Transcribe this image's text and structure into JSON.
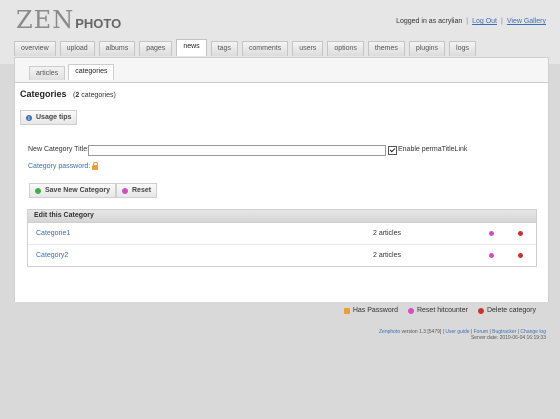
{
  "header": {
    "logo_zen": "ZEN",
    "logo_photo": "PHOTO",
    "logged_in_text": "Logged in as acrylian",
    "logout_label": "Log Out",
    "view_gallery_label": "View Gallery",
    "separator": "|"
  },
  "tabs": [
    {
      "label": "overview"
    },
    {
      "label": "upload"
    },
    {
      "label": "albums"
    },
    {
      "label": "pages"
    },
    {
      "label": "news",
      "active": true
    },
    {
      "label": "tags"
    },
    {
      "label": "comments"
    },
    {
      "label": "users"
    },
    {
      "label": "options"
    },
    {
      "label": "themes"
    },
    {
      "label": "plugins"
    },
    {
      "label": "logs"
    }
  ],
  "subtabs": [
    {
      "label": "articles"
    },
    {
      "label": "categories",
      "active": true
    }
  ],
  "page": {
    "title": "Categories",
    "count_open": "(",
    "count_value": "2",
    "count_rest": " categories)",
    "usage_tips_label": "Usage tips"
  },
  "form": {
    "title_label": "New Category Title:",
    "title_value": "",
    "permalink_label": "Enable permaTitleLink",
    "permalink_checked": true,
    "password_label": "Category password:",
    "save_label": "Save New Category",
    "reset_label": "Reset"
  },
  "table": {
    "header": "Edit this Category",
    "rows": [
      {
        "name": "Categorie1",
        "articles": "2 articles"
      },
      {
        "name": "Category2",
        "articles": "2 articles"
      }
    ]
  },
  "legend": {
    "has_password": "Has Password",
    "reset_hitcounter": "Reset hitcounter",
    "delete_category": "Delete category"
  },
  "footer": {
    "brand": "Zenphoto",
    "version_text": " version 1.3 [5479] | ",
    "user_guide": "User guide",
    "forum": "Forum",
    "bugtracker": "Bugtracker",
    "changelog": "Change log",
    "sep": " | ",
    "server_date": "Server date: 2010-06-04 16:19:33"
  },
  "colors": {
    "link": "#3b6fb6",
    "reset_icon": "#d04fc0",
    "delete_icon": "#c83232",
    "save_icon": "#3cb043",
    "lock_icon": "#e5a23a"
  }
}
